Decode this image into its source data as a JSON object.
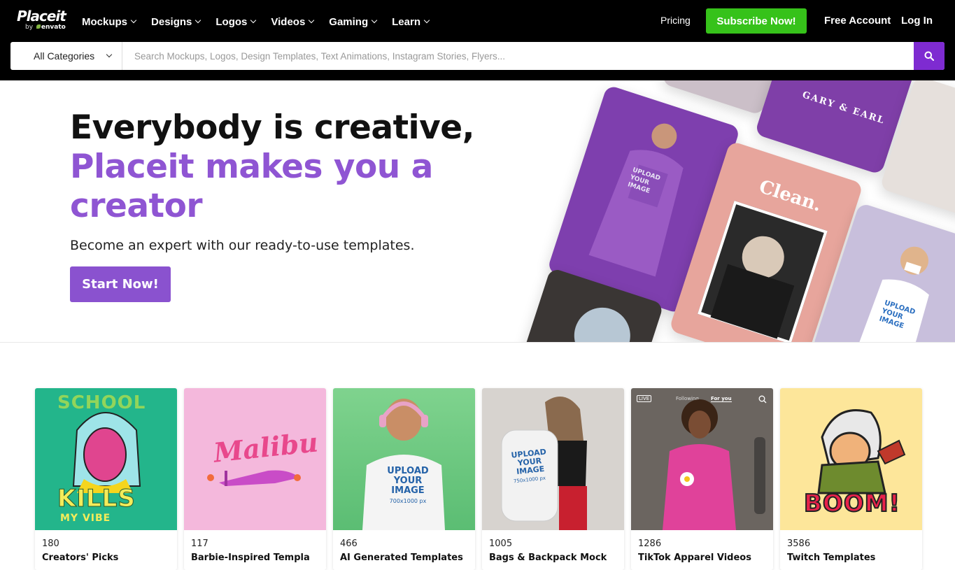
{
  "brand": {
    "logo_word": "Placeit",
    "by": "by",
    "by_brand": "envato"
  },
  "nav": {
    "items": [
      {
        "label": "Mockups"
      },
      {
        "label": "Designs"
      },
      {
        "label": "Logos"
      },
      {
        "label": "Videos"
      },
      {
        "label": "Gaming"
      },
      {
        "label": "Learn"
      }
    ],
    "pricing": "Pricing",
    "subscribe": "Subscribe Now!",
    "free_account": "Free Account",
    "login": "Log In"
  },
  "search": {
    "category": "All Categories",
    "placeholder": "Search Mockups, Logos, Design Templates, Text Animations, Instagram Stories, Flyers..."
  },
  "hero": {
    "line1": "Everybody is creative,",
    "line2": "Placeit makes you a",
    "line3": "creator",
    "subtitle": "Become an expert with our ready-to-use templates.",
    "cta": "Start Now!",
    "collage": {
      "tile_gary": "GARY & EARL",
      "tile_clean": "Clean.",
      "upload": "UPLOAD YOUR IMAGE"
    }
  },
  "cards": [
    {
      "count": "180",
      "title": "Creators' Picks",
      "art_top": "SCHOOL",
      "art_mid": "KILLS",
      "art_bot": "MY VIBE"
    },
    {
      "count": "117",
      "title": "Barbie-Inspired Templa",
      "art": "Malibu"
    },
    {
      "count": "466",
      "title": "AI Generated Templates",
      "art": "UPLOAD YOUR IMAGE",
      "art_size": "700x1000 px"
    },
    {
      "count": "1005",
      "title": "Bags & Backpack Mock",
      "art": "UPLOAD YOUR IMAGE",
      "art_size": "750x1000 px"
    },
    {
      "count": "1286",
      "title": "TikTok Apparel Videos",
      "live": "LIVE",
      "following": "Following",
      "for_you": "For you"
    },
    {
      "count": "3586",
      "title": "Twitch Templates",
      "art": "BOOM!"
    }
  ],
  "colors": {
    "accent_purple": "#8f55d3",
    "subscribe_green": "#36c21a",
    "search_button": "#7e2bd1"
  }
}
